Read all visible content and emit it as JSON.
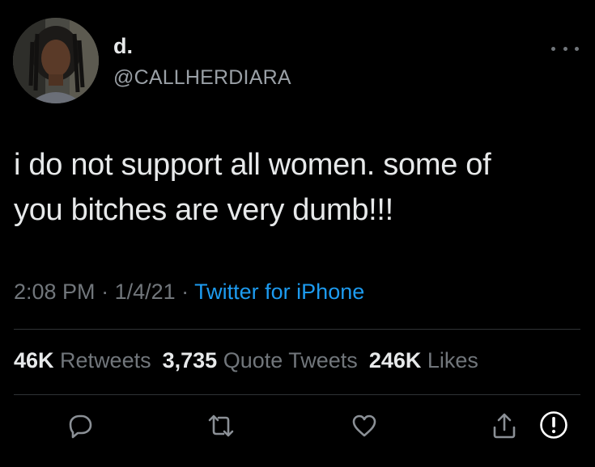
{
  "author": {
    "display_name": "d.",
    "handle": "@CALLHERDIARA"
  },
  "tweet": {
    "text_line1": "i do not support all women. some of",
    "text_line2": "you bitches are very dumb!!!"
  },
  "meta": {
    "time": "2:08 PM",
    "separator": " · ",
    "date": "1/4/21",
    "source": "Twitter for iPhone"
  },
  "stats": {
    "retweets_count": "46K",
    "retweets_label": "Retweets",
    "quote_count": "3,735",
    "quote_label": "Quote Tweets",
    "likes_count": "246K",
    "likes_label": "Likes"
  },
  "actions": {
    "icons": [
      "reply-icon",
      "retweet-icon",
      "like-icon",
      "share-icon",
      "report-icon"
    ]
  },
  "colors": {
    "background": "#000000",
    "text": "#e7e9ea",
    "secondary": "#71767b",
    "link": "#1d9bf0",
    "divider": "#2f3336"
  }
}
